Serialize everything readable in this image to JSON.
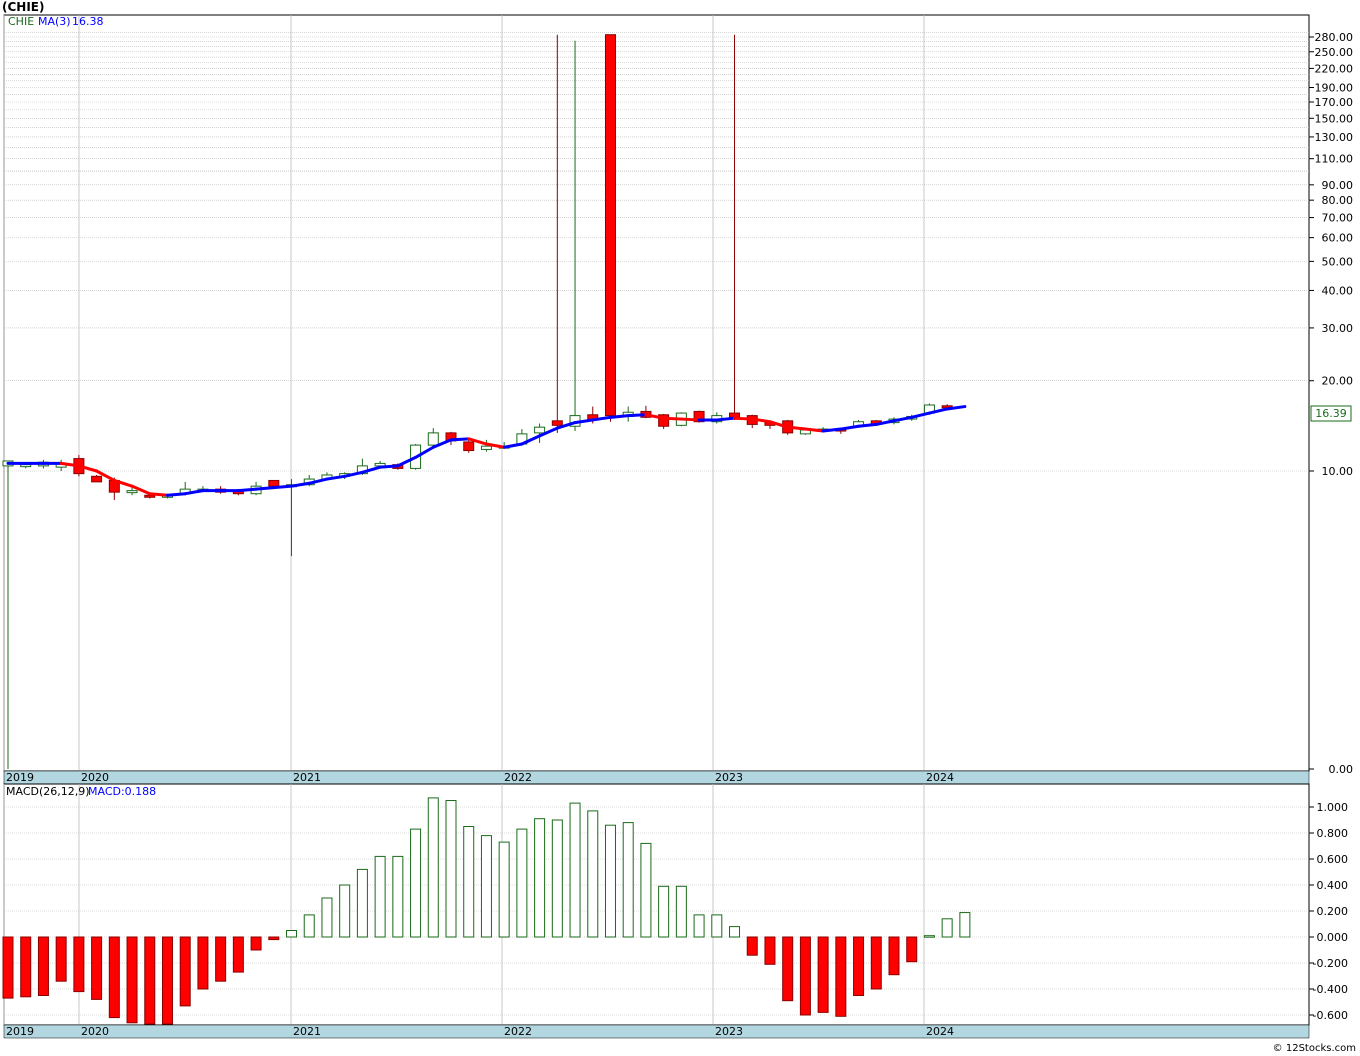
{
  "title": "(CHIE)",
  "credit": "© 12Stocks.com",
  "colors": {
    "up": "#1a6b1a",
    "down": "#ff0000",
    "ma_up": "#0000ff",
    "ma_down": "#ff0000",
    "axis_band": "#b3d7e0",
    "macd_up": "#1a6b1a",
    "macd_down": "#ff0000"
  },
  "price_panel": {
    "legend_symbol": "CHIE",
    "legend_ma": "MA(3)",
    "legend_ma_value": "16.38",
    "last_price_label": "16.39",
    "y_tick_labels": [
      "280.00",
      "250.00",
      "220.00",
      "190.00",
      "170.00",
      "150.00",
      "130.00",
      "110.00",
      "90.00",
      "80.00",
      "70.00",
      "60.00",
      "50.00",
      "40.00",
      "30.00",
      "20.00",
      "10.00",
      "0.00"
    ],
    "x_labels": [
      "2019",
      "2020",
      "2021",
      "2022",
      "2023",
      "2024"
    ]
  },
  "macd_panel": {
    "legend_name": "MACD(26,12,9)",
    "legend_value": "MACD:0.188",
    "y_tick_labels": [
      "1.000",
      "0.800",
      "0.600",
      "0.400",
      "0.200",
      "0.000",
      "-0.200",
      "-0.400",
      "-0.600"
    ],
    "x_labels": [
      "2019",
      "2020",
      "2021",
      "2022",
      "2023",
      "2024"
    ]
  },
  "chart_data": [
    {
      "type": "candlestick",
      "scale": "log",
      "ylim": [
        0,
        290
      ],
      "xlim": [
        "2019-12",
        "2024-03"
      ],
      "candles": [
        {
          "o": 10.4,
          "h": 10.8,
          "l": 0.1,
          "c": 10.8
        },
        {
          "o": 10.5,
          "h": 10.7,
          "l": 10.2,
          "c": 10.5
        },
        {
          "o": 10.4,
          "h": 10.9,
          "l": 10.2,
          "c": 10.7
        },
        {
          "o": 10.3,
          "h": 10.9,
          "l": 10.0,
          "c": 10.6
        },
        {
          "o": 11.0,
          "h": 11.3,
          "l": 9.6,
          "c": 9.8
        },
        {
          "o": 9.6,
          "h": 9.7,
          "l": 9.2,
          "c": 9.2
        },
        {
          "o": 9.3,
          "h": 9.5,
          "l": 8.0,
          "c": 8.5
        },
        {
          "o": 8.5,
          "h": 8.8,
          "l": 8.3,
          "c": 8.6
        },
        {
          "o": 8.3,
          "h": 8.4,
          "l": 8.1,
          "c": 8.2
        },
        {
          "o": 8.2,
          "h": 8.4,
          "l": 8.1,
          "c": 8.3
        },
        {
          "o": 8.4,
          "h": 9.2,
          "l": 8.3,
          "c": 8.7
        },
        {
          "o": 8.6,
          "h": 8.9,
          "l": 8.5,
          "c": 8.7
        },
        {
          "o": 8.7,
          "h": 8.9,
          "l": 8.4,
          "c": 8.5
        },
        {
          "o": 8.6,
          "h": 8.7,
          "l": 8.3,
          "c": 8.4
        },
        {
          "o": 8.4,
          "h": 9.2,
          "l": 8.3,
          "c": 8.9
        },
        {
          "o": 9.3,
          "h": 9.3,
          "l": 8.9,
          "c": 8.9
        },
        {
          "o": 8.9,
          "h": 9.4,
          "l": 5.2,
          "c": 9.0
        },
        {
          "o": 9.0,
          "h": 9.7,
          "l": 8.9,
          "c": 9.4
        },
        {
          "o": 9.4,
          "h": 9.9,
          "l": 9.3,
          "c": 9.7
        },
        {
          "o": 9.6,
          "h": 9.9,
          "l": 9.4,
          "c": 9.8
        },
        {
          "o": 9.8,
          "h": 11.0,
          "l": 9.7,
          "c": 10.4
        },
        {
          "o": 10.4,
          "h": 10.8,
          "l": 10.2,
          "c": 10.6
        },
        {
          "o": 10.5,
          "h": 10.6,
          "l": 10.1,
          "c": 10.2
        },
        {
          "o": 10.2,
          "h": 12.3,
          "l": 10.1,
          "c": 12.2
        },
        {
          "o": 12.2,
          "h": 13.9,
          "l": 12.0,
          "c": 13.4
        },
        {
          "o": 13.4,
          "h": 13.5,
          "l": 12.2,
          "c": 12.6
        },
        {
          "o": 12.5,
          "h": 12.8,
          "l": 11.5,
          "c": 11.7
        },
        {
          "o": 11.8,
          "h": 12.7,
          "l": 11.6,
          "c": 12.1
        },
        {
          "o": 12.1,
          "h": 12.5,
          "l": 12.0,
          "c": 12.1
        },
        {
          "o": 12.3,
          "h": 13.8,
          "l": 12.2,
          "c": 13.3
        },
        {
          "o": 13.4,
          "h": 14.4,
          "l": 12.4,
          "c": 14.0
        },
        {
          "o": 14.7,
          "h": 285,
          "l": 13.4,
          "c": 14.2
        },
        {
          "o": 14.1,
          "h": 272,
          "l": 13.6,
          "c": 15.3
        },
        {
          "o": 15.4,
          "h": 16.4,
          "l": 14.4,
          "c": 14.9
        },
        {
          "o": 285,
          "h": 285,
          "l": 14.6,
          "c": 15.3
        },
        {
          "o": 15.2,
          "h": 16.4,
          "l": 14.6,
          "c": 15.7
        },
        {
          "o": 15.8,
          "h": 16.5,
          "l": 15.0,
          "c": 15.1
        },
        {
          "o": 15.4,
          "h": 15.5,
          "l": 13.8,
          "c": 14.1
        },
        {
          "o": 14.2,
          "h": 15.7,
          "l": 14.1,
          "c": 15.6
        },
        {
          "o": 15.8,
          "h": 15.9,
          "l": 14.5,
          "c": 14.6
        },
        {
          "o": 14.6,
          "h": 15.7,
          "l": 14.4,
          "c": 15.3
        },
        {
          "o": 15.6,
          "h": 285,
          "l": 14.8,
          "c": 15.1
        },
        {
          "o": 15.3,
          "h": 15.4,
          "l": 13.9,
          "c": 14.3
        },
        {
          "o": 14.5,
          "h": 14.6,
          "l": 13.8,
          "c": 14.2
        },
        {
          "o": 14.7,
          "h": 14.8,
          "l": 13.2,
          "c": 13.4
        },
        {
          "o": 13.3,
          "h": 13.9,
          "l": 13.2,
          "c": 13.7
        },
        {
          "o": 13.8,
          "h": 14.0,
          "l": 13.6,
          "c": 13.8
        },
        {
          "o": 13.8,
          "h": 13.9,
          "l": 13.3,
          "c": 13.7
        },
        {
          "o": 14.1,
          "h": 14.8,
          "l": 14.0,
          "c": 14.6
        },
        {
          "o": 14.7,
          "h": 14.8,
          "l": 14.2,
          "c": 14.3
        },
        {
          "o": 14.5,
          "h": 15.1,
          "l": 14.3,
          "c": 14.9
        },
        {
          "o": 14.9,
          "h": 15.4,
          "l": 14.7,
          "c": 15.2
        },
        {
          "o": 15.6,
          "h": 16.8,
          "l": 15.4,
          "c": 16.6
        },
        {
          "o": 16.5,
          "h": 16.7,
          "l": 16.1,
          "c": 16.4
        }
      ],
      "ma3": [
        10.6,
        10.6,
        10.6,
        10.6,
        10.4,
        10.0,
        9.3,
        8.9,
        8.4,
        8.3,
        8.4,
        8.6,
        8.6,
        8.6,
        8.7,
        8.8,
        8.9,
        9.1,
        9.4,
        9.6,
        9.9,
        10.3,
        10.4,
        11.1,
        12.0,
        12.7,
        12.8,
        12.3,
        12.0,
        12.3,
        13.1,
        13.9,
        14.5,
        14.8,
        15.1,
        15.3,
        15.4,
        15.0,
        14.9,
        14.8,
        14.8,
        15.0,
        14.9,
        14.6,
        14.0,
        13.8,
        13.6,
        13.8,
        14.1,
        14.3,
        14.7,
        15.1,
        15.6,
        16.1,
        16.4
      ]
    },
    {
      "type": "bar",
      "name": "MACD(26,12,9)",
      "ylim": [
        -0.7,
        1.1
      ],
      "values": [
        -0.47,
        -0.46,
        -0.45,
        -0.34,
        -0.42,
        -0.48,
        -0.62,
        -0.66,
        -0.68,
        -0.67,
        -0.53,
        -0.4,
        -0.34,
        -0.27,
        -0.1,
        -0.02,
        0.05,
        0.17,
        0.3,
        0.4,
        0.52,
        0.62,
        0.62,
        0.83,
        1.07,
        1.05,
        0.85,
        0.78,
        0.73,
        0.83,
        0.91,
        0.9,
        1.03,
        0.97,
        0.86,
        0.88,
        0.72,
        0.39,
        0.39,
        0.17,
        0.17,
        0.08,
        -0.14,
        -0.21,
        -0.49,
        -0.6,
        -0.58,
        -0.61,
        -0.45,
        -0.4,
        -0.29,
        -0.19,
        0.01,
        0.14,
        0.188
      ]
    }
  ]
}
